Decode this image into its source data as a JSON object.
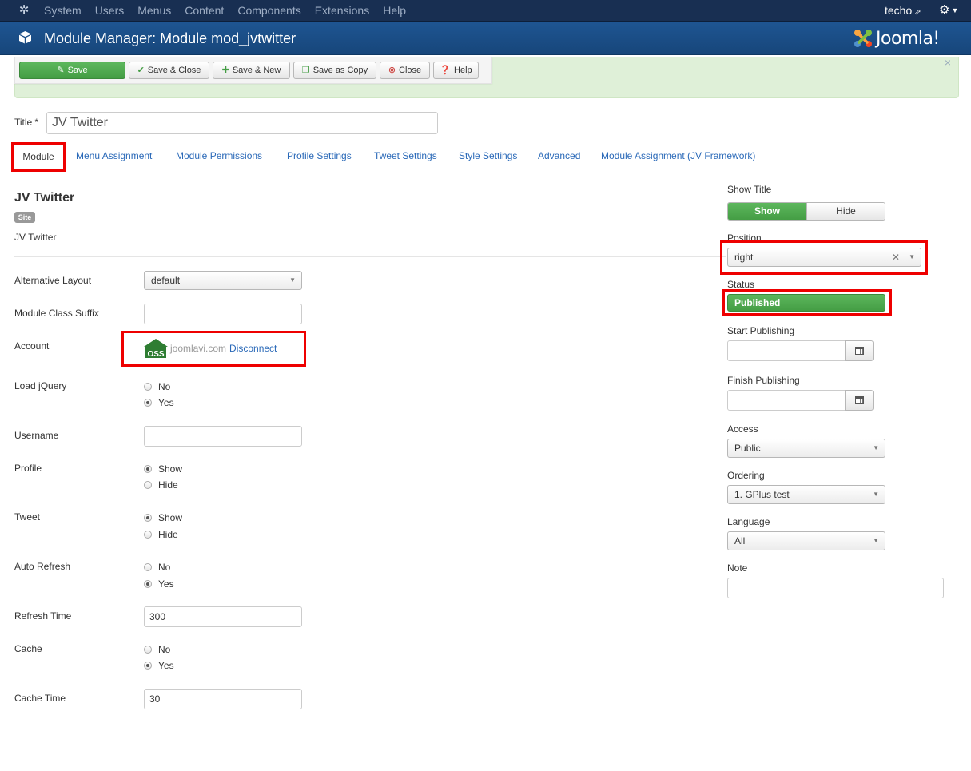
{
  "topbar": {
    "menu": [
      "System",
      "Users",
      "Menus",
      "Content",
      "Components",
      "Extensions",
      "Help"
    ],
    "user": "techo"
  },
  "header": {
    "title": "Module Manager: Module mod_jvtwitter",
    "brand": "Joomla!"
  },
  "toolbar": {
    "save": "Save",
    "save_close": "Save & Close",
    "save_new": "Save & New",
    "save_copy": "Save as Copy",
    "close": "Close",
    "help": "Help"
  },
  "message": {
    "close": "×"
  },
  "title_field": {
    "label": "Title *",
    "value": "JV Twitter"
  },
  "tabs": [
    "Module",
    "Menu Assignment",
    "Module Permissions",
    "Profile Settings",
    "Tweet Settings",
    "Style Settings",
    "Advanced",
    "Module Assignment (JV Framework)"
  ],
  "module_info": {
    "name": "JV Twitter",
    "badge": "Site",
    "description": "JV Twitter"
  },
  "form": {
    "alt_layout": {
      "label": "Alternative Layout",
      "value": "default"
    },
    "class_suffix": {
      "label": "Module Class Suffix",
      "value": ""
    },
    "account": {
      "label": "Account",
      "domain": "joomlavi.com",
      "link": "Disconnect"
    },
    "load_jquery": {
      "label": "Load jQuery",
      "options": [
        "No",
        "Yes"
      ],
      "selected": "Yes"
    },
    "username": {
      "label": "Username",
      "value": ""
    },
    "profile": {
      "label": "Profile",
      "options": [
        "Show",
        "Hide"
      ],
      "selected": "Show"
    },
    "tweet": {
      "label": "Tweet",
      "options": [
        "Show",
        "Hide"
      ],
      "selected": "Show"
    },
    "auto_refresh": {
      "label": "Auto Refresh",
      "options": [
        "No",
        "Yes"
      ],
      "selected": "Yes"
    },
    "refresh_time": {
      "label": "Refresh Time",
      "value": "300"
    },
    "cache": {
      "label": "Cache",
      "options": [
        "No",
        "Yes"
      ],
      "selected": "Yes"
    },
    "cache_time": {
      "label": "Cache Time",
      "value": "30"
    }
  },
  "sidebar": {
    "show_title": {
      "label": "Show Title",
      "options": [
        "Show",
        "Hide"
      ],
      "selected": "Show"
    },
    "position": {
      "label": "Position",
      "value": "right"
    },
    "status": {
      "label": "Status",
      "value": "Published"
    },
    "start_publishing": {
      "label": "Start Publishing",
      "value": ""
    },
    "finish_publishing": {
      "label": "Finish Publishing",
      "value": ""
    },
    "access": {
      "label": "Access",
      "value": "Public"
    },
    "ordering": {
      "label": "Ordering",
      "value": "1. GPlus test"
    },
    "language": {
      "label": "Language",
      "value": "All"
    },
    "note": {
      "label": "Note",
      "value": ""
    }
  },
  "colors": {
    "topbar": "#182f52",
    "header": "#1a4f8a",
    "success": "#46a546",
    "link": "#2a69b8",
    "highlight": "#e00000"
  },
  "icons": {
    "joomla": "joomla-icon",
    "cube": "cube-icon",
    "gear": "gear-icon",
    "calendar": "calendar-icon"
  }
}
